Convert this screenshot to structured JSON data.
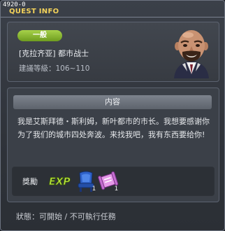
{
  "window": {
    "id_label": "4920-0",
    "title": "QUEST INFO"
  },
  "quest": {
    "category": "一般",
    "name": "[克拉齐亚] 都市战士",
    "level_label": "建議等級：106~110"
  },
  "content": {
    "header": "内容",
    "description": "我是艾斯拜德・斯利姆，新叶都市的市长。我想要感谢你为了我们的城市四处奔波。来找我吧，我有东西要给你!"
  },
  "reward": {
    "label": "獎勵",
    "exp_text": "EXP",
    "items": [
      {
        "icon": "blue-chair-icon",
        "count": "1"
      },
      {
        "icon": "pink-scroll-icon",
        "count": "1"
      }
    ]
  },
  "status": {
    "text": "狀態：可開始 / 不可執行任務"
  },
  "colors": {
    "title": "#f4d35a",
    "tag_green": "#8fbf2f",
    "background": "#2f333a"
  }
}
